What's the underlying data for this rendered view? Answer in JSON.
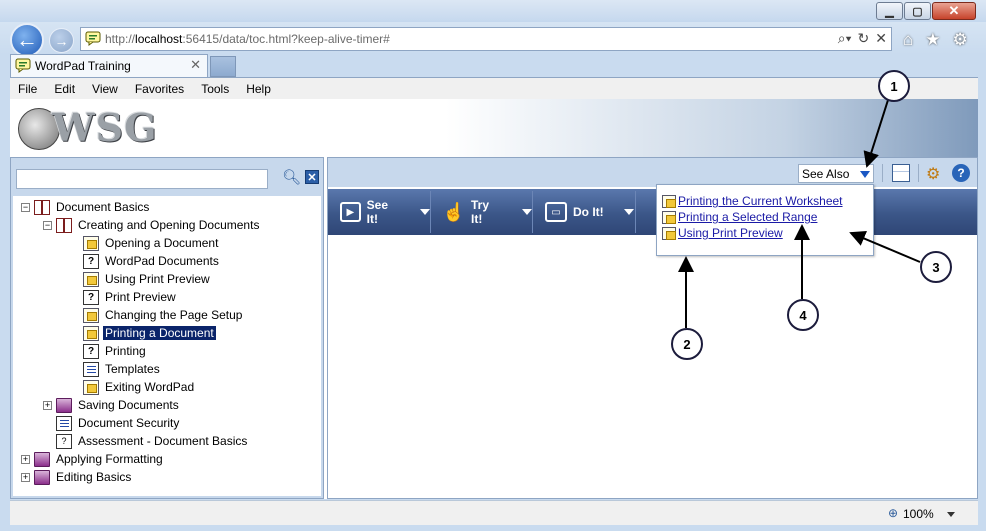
{
  "browser": {
    "address_host": "http://",
    "address_domain": "localhost",
    "address_rest": ":56415/data/toc.html?keep-alive-timer#",
    "tab_title": "WordPad Training",
    "zoom": "100%"
  },
  "menu": [
    "File",
    "Edit",
    "View",
    "Favorites",
    "Tools",
    "Help"
  ],
  "brand": {
    "logo_text": "WSG"
  },
  "toc": {
    "items": [
      {
        "label": "Document Basics",
        "level": 0,
        "icon": "book-open-icon",
        "expander": "-"
      },
      {
        "label": "Creating and Opening Documents",
        "level": 1,
        "icon": "book-open-icon",
        "expander": "-"
      },
      {
        "label": "Opening a Document",
        "level": 2,
        "icon": "topic-icon",
        "expander": ""
      },
      {
        "label": "WordPad Documents",
        "level": 2,
        "icon": "help-page-icon",
        "expander": ""
      },
      {
        "label": "Using Print Preview",
        "level": 2,
        "icon": "topic-icon",
        "expander": ""
      },
      {
        "label": "Print Preview",
        "level": 2,
        "icon": "help-page-icon",
        "expander": ""
      },
      {
        "label": "Changing the Page Setup",
        "level": 2,
        "icon": "topic-icon",
        "expander": ""
      },
      {
        "label": "Printing a Document",
        "level": 2,
        "icon": "topic-icon",
        "expander": "",
        "selected": true
      },
      {
        "label": "Printing",
        "level": 2,
        "icon": "help-page-icon",
        "expander": ""
      },
      {
        "label": "Templates",
        "level": 2,
        "icon": "document-icon",
        "expander": ""
      },
      {
        "label": "Exiting WordPad",
        "level": 2,
        "icon": "topic-icon",
        "expander": ""
      },
      {
        "label": "Saving Documents",
        "level": 1,
        "icon": "book-icon",
        "expander": "+"
      },
      {
        "label": "Document Security",
        "level": 1,
        "icon": "document-icon",
        "expander": ""
      },
      {
        "label": "Assessment - Document Basics",
        "level": 1,
        "icon": "assessment-icon",
        "expander": ""
      },
      {
        "label": "Applying Formatting",
        "level": 0,
        "icon": "book-icon",
        "expander": "+"
      },
      {
        "label": "Editing Basics",
        "level": 0,
        "icon": "book-icon",
        "expander": "+"
      }
    ]
  },
  "toolbar": {
    "see_also_label": "See Also"
  },
  "actions": [
    {
      "label": "See It!",
      "icon": "play-icon"
    },
    {
      "label": "Try It!",
      "icon": "hand-pointer-icon"
    },
    {
      "label": "Do It!",
      "icon": "do-it-icon"
    }
  ],
  "see_also_links": [
    "Printing the Current Worksheet",
    "Printing a Selected Range",
    "Using Print Preview"
  ],
  "callouts": [
    "1",
    "2",
    "3",
    "4"
  ]
}
